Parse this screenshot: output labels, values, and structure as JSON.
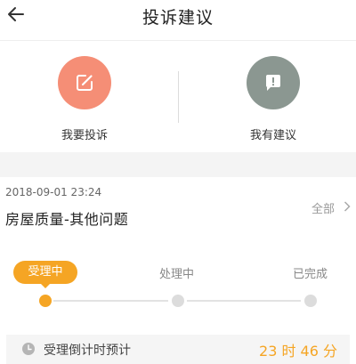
{
  "header": {
    "title": "投诉建议"
  },
  "actions": {
    "complain_label": "我要投诉",
    "suggest_label": "我有建议"
  },
  "record": {
    "timestamp": "2018-09-01 23:24",
    "title": "房屋质量-其他问题",
    "filter_label": "全部"
  },
  "progress": {
    "steps": [
      {
        "label": "受理中",
        "state": "active"
      },
      {
        "label": "处理中",
        "state": "pending"
      },
      {
        "label": "已完成",
        "state": "pending"
      }
    ]
  },
  "countdown": {
    "label": "受理倒计时预计",
    "value": "23 时 46 分"
  },
  "colors": {
    "accent_orange": "#f5a524",
    "complain_salmon": "#f58e76",
    "suggest_gray": "#8b9791"
  },
  "icons": {
    "back": "arrow-left-icon",
    "complain": "edit-icon",
    "suggest": "exclamation-bubble-icon",
    "filter_chevron": "chevron-right-icon",
    "countdown": "clock-icon"
  }
}
